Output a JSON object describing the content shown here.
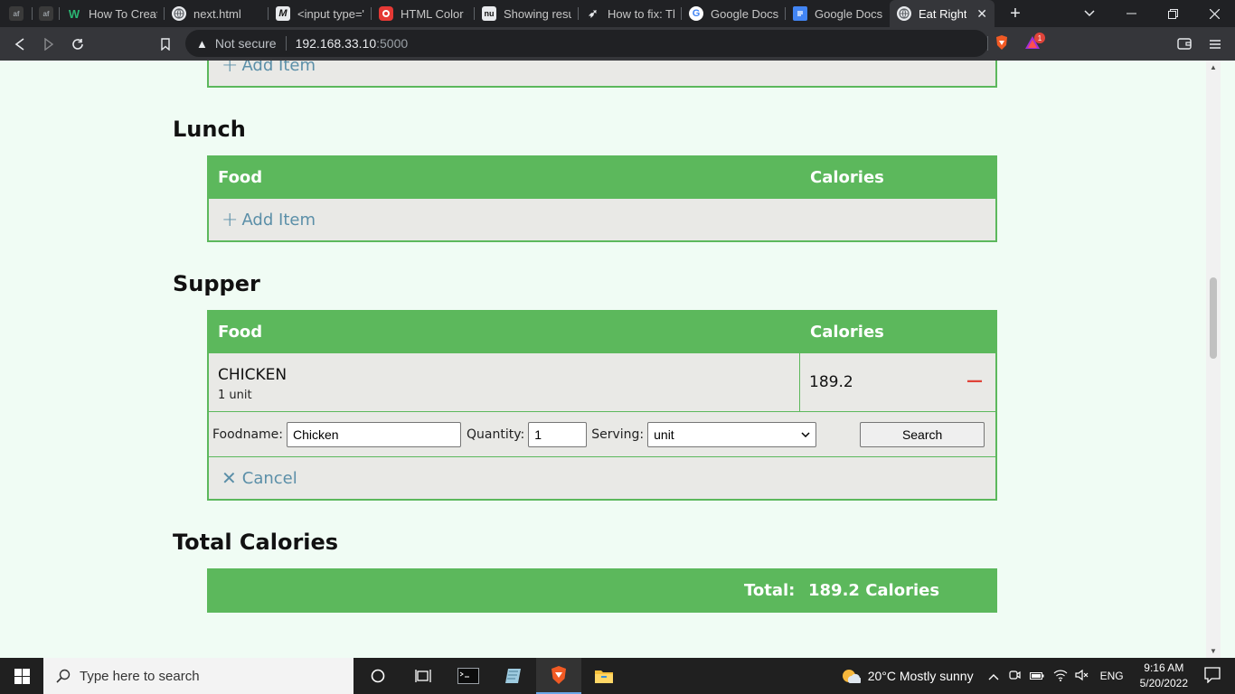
{
  "browser": {
    "tabs": [
      {
        "title": "",
        "favicon": "af-icon",
        "color": "#3a3a3a"
      },
      {
        "title": "",
        "favicon": "af-icon",
        "color": "#3a3a3a"
      },
      {
        "title": "How To Create",
        "favicon": "w-icon",
        "color": "#2bb673"
      },
      {
        "title": "next.html",
        "favicon": "globe-icon",
        "color": "#5f6368"
      },
      {
        "title": "<input type=\"",
        "favicon": "m-icon",
        "color": "#111111"
      },
      {
        "title": "HTML Color Cc",
        "favicon": "target-icon",
        "color": "#e53935"
      },
      {
        "title": "Showing result",
        "favicon": "nu-icon",
        "color": "#111111"
      },
      {
        "title": "How to fix: The",
        "favicon": "rocket-icon",
        "color": "#111111"
      },
      {
        "title": "Google Docs: C",
        "favicon": "google-icon",
        "color": "#ffffff"
      },
      {
        "title": "Google Docs",
        "favicon": "docs-icon",
        "color": "#4285f4"
      },
      {
        "title": "Eat Right",
        "favicon": "globe-icon",
        "color": "#5f6368",
        "active": true
      }
    ],
    "address": {
      "security_label": "Not secure",
      "host": "192.168.33.10",
      "port": ":5000"
    },
    "extensions_badge": "1"
  },
  "page": {
    "breakfast": {
      "add_label": "Add Item"
    },
    "lunch": {
      "title": "Lunch",
      "food_header": "Food",
      "calories_header": "Calories",
      "add_label": "Add Item"
    },
    "supper": {
      "title": "Supper",
      "food_header": "Food",
      "calories_header": "Calories",
      "items": [
        {
          "name": "CHICKEN",
          "serving": "1 unit",
          "calories": "189.2"
        }
      ],
      "form": {
        "foodname_label": "Foodname:",
        "foodname_value": "Chicken",
        "quantity_label": "Quantity:",
        "quantity_value": "1",
        "serving_label": "Serving:",
        "serving_value": "unit",
        "search_label": "Search"
      },
      "cancel_label": "Cancel"
    },
    "total": {
      "title": "Total Calories",
      "label": "Total:",
      "value": "189.2 Calories"
    }
  },
  "taskbar": {
    "search_placeholder": "Type here to search",
    "weather": "20°C  Mostly sunny",
    "language": "ENG",
    "time": "9:16 AM",
    "date": "5/20/2022"
  },
  "colors": {
    "accent_green": "#5cb85c",
    "page_bg": "#f0fcf4",
    "link_blue": "#5b8fa8",
    "remove_red": "#e0443a"
  }
}
